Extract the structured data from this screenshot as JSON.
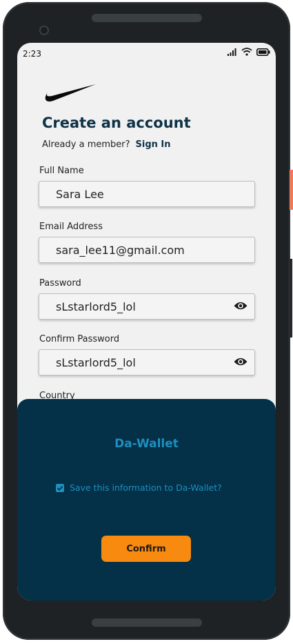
{
  "status_bar": {
    "time": "2:23"
  },
  "header": {
    "title": "Create an account",
    "member_prompt": "Already a member?",
    "sign_in": "Sign In"
  },
  "form": {
    "full_name": {
      "label": "Full Name",
      "value": "Sara Lee"
    },
    "email": {
      "label": "Email Address",
      "value": "sara_lee11@gmail.com"
    },
    "password": {
      "label": "Password",
      "value": "sLstarlord5_lol"
    },
    "confirm_password": {
      "label": "Confirm Password",
      "value": "sLstarlord5_lol"
    },
    "country": {
      "label": "Country"
    }
  },
  "wallet_sheet": {
    "title": "Da-Wallet",
    "save_label": "Save this information to Da-Wallet?",
    "save_checked": true,
    "confirm_label": "Confirm"
  },
  "colors": {
    "heading": "#0f3247",
    "sheet_bg": "#043048",
    "sheet_accent": "#1f8fbf",
    "confirm_button": "#f88a0f",
    "screen_bg": "#f1f1f1"
  }
}
